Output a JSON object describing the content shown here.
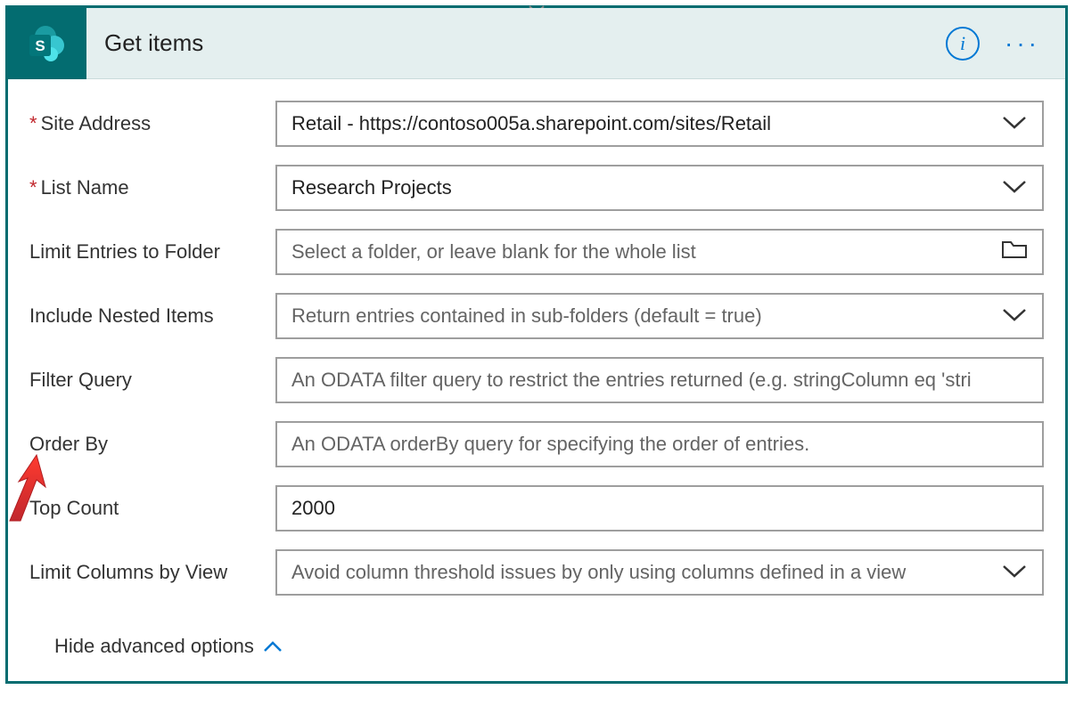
{
  "header": {
    "title": "Get items"
  },
  "fields": {
    "siteAddress": {
      "label": "Site Address",
      "value": "Retail - https://contoso005a.sharepoint.com/sites/Retail"
    },
    "listName": {
      "label": "List Name",
      "value": "Research Projects"
    },
    "limitFolder": {
      "label": "Limit Entries to Folder",
      "placeholder": "Select a folder, or leave blank for the whole list"
    },
    "includeNested": {
      "label": "Include Nested Items",
      "placeholder": "Return entries contained in sub-folders (default = true)"
    },
    "filterQuery": {
      "label": "Filter Query",
      "placeholder": "An ODATA filter query to restrict the entries returned (e.g. stringColumn eq 'stri"
    },
    "orderBy": {
      "label": "Order By",
      "placeholder": "An ODATA orderBy query for specifying the order of entries."
    },
    "topCount": {
      "label": "Top Count",
      "value": "2000"
    },
    "limitColumns": {
      "label": "Limit Columns by View",
      "placeholder": "Avoid column threshold issues by only using columns defined in a view"
    }
  },
  "hideAdvanced": "Hide advanced options"
}
